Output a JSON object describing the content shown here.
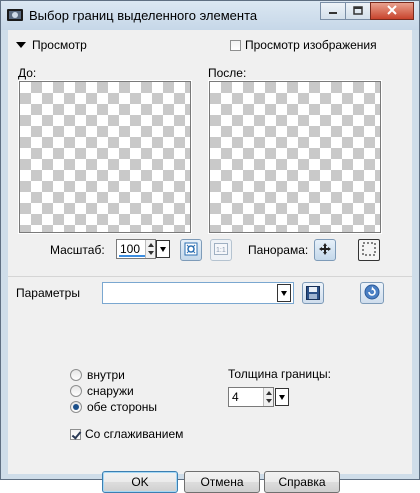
{
  "window": {
    "title": "Выбор границ выделенного элемента"
  },
  "preview": {
    "toggle_label": "Просмотр",
    "preview_images_label": "Просмотр изображения",
    "preview_images_checked": false,
    "before_label": "До:",
    "after_label": "После:"
  },
  "zoom": {
    "label": "Масштаб:",
    "value": "100"
  },
  "pan": {
    "label": "Панорама:"
  },
  "params": {
    "label": "Параметры",
    "value": ""
  },
  "options": {
    "radios": [
      {
        "label": "внутри",
        "selected": false
      },
      {
        "label": "снаружи",
        "selected": false
      },
      {
        "label": "обе стороны",
        "selected": true
      }
    ],
    "thickness_label": "Толщина границы:",
    "thickness_value": "4",
    "antialias_label": "Со сглаживанием",
    "antialias_checked": true
  },
  "buttons": {
    "ok": "OK",
    "cancel": "Отмена",
    "help": "Справка"
  },
  "colors": {
    "accent": "#3b8de0",
    "title_bg": "#c6d7e8"
  },
  "icons": [
    "app-icon",
    "minimize-icon",
    "maximize-icon",
    "close-icon",
    "chevron-down-icon",
    "zoom-fit-icon",
    "actual-size-icon",
    "pan-move-icon",
    "selection-icon",
    "save-icon",
    "reset-icon"
  ]
}
